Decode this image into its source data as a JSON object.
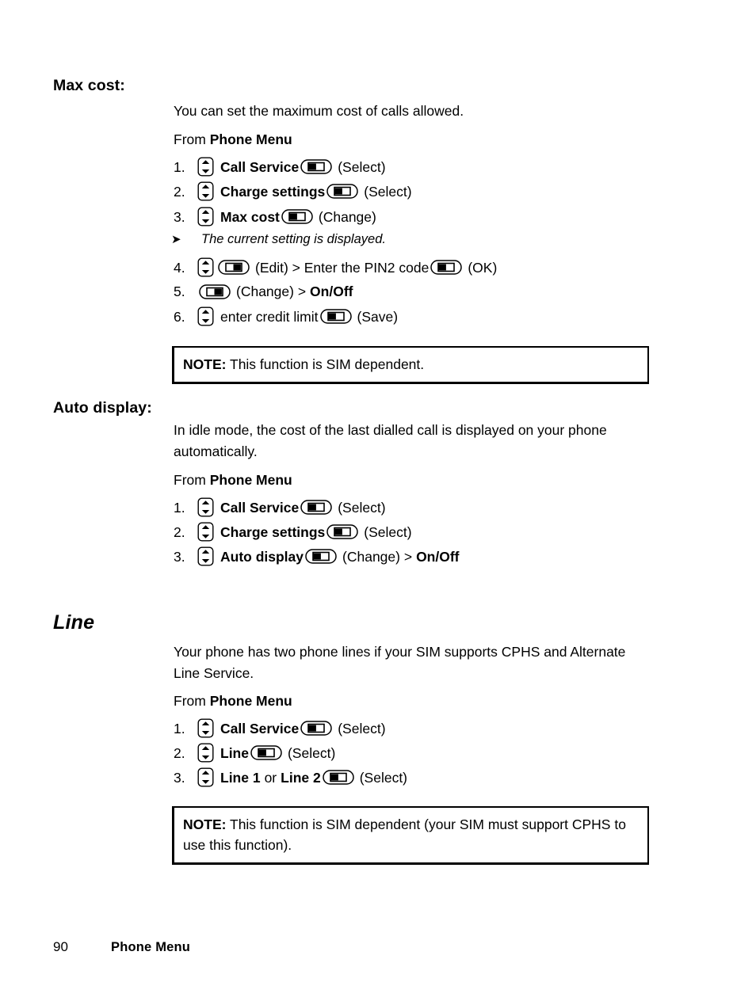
{
  "page": {
    "number": "90",
    "footer_title": "Phone Menu"
  },
  "icons": {
    "scroll_key": "scroll-up-down-key-icon",
    "softkey_left": "left-soft-key-icon",
    "softkey_right": "right-soft-key-icon",
    "tip_arrow": "➤"
  },
  "sections": [
    {
      "id": "max-cost",
      "heading": "Max cost:",
      "heading_style": "sub",
      "intro": "You can set the maximum cost of calls allowed.",
      "from_prefix": "From ",
      "from_target": "Phone Menu",
      "steps": [
        {
          "num": "1.",
          "parts": [
            {
              "t": "icon",
              "icon": "scroll"
            },
            {
              "t": "bold",
              "text": "Call Service"
            },
            {
              "t": "icon",
              "icon": "softkey_left"
            },
            {
              "t": "plain",
              "text": "(Select)"
            }
          ]
        },
        {
          "num": "2.",
          "parts": [
            {
              "t": "icon",
              "icon": "scroll"
            },
            {
              "t": "bold",
              "text": "Charge settings"
            },
            {
              "t": "icon",
              "icon": "softkey_left"
            },
            {
              "t": "plain",
              "text": "(Select)"
            }
          ]
        },
        {
          "num": "3.",
          "parts": [
            {
              "t": "icon",
              "icon": "scroll"
            },
            {
              "t": "bold",
              "text": "Max cost"
            },
            {
              "t": "icon",
              "icon": "softkey_left"
            },
            {
              "t": "plain",
              "text": "(Change)"
            }
          ]
        },
        {
          "num": "tip",
          "tip": "The current setting is displayed."
        },
        {
          "num": "4.",
          "parts": [
            {
              "t": "icon",
              "icon": "scroll"
            },
            {
              "t": "icon",
              "icon": "softkey_right"
            },
            {
              "t": "plain",
              "text": "(Edit) > Enter the PIN2 code"
            },
            {
              "t": "icon",
              "icon": "softkey_left"
            },
            {
              "t": "plain",
              "text": "(OK)"
            }
          ]
        },
        {
          "num": "5.",
          "parts": [
            {
              "t": "icon",
              "icon": "softkey_right"
            },
            {
              "t": "plain",
              "text": "(Change) >"
            },
            {
              "t": "bold",
              "text": "On/Off"
            }
          ]
        },
        {
          "num": "6.",
          "parts": [
            {
              "t": "icon",
              "icon": "scroll"
            },
            {
              "t": "plain",
              "text": "enter credit limit"
            },
            {
              "t": "icon",
              "icon": "softkey_left"
            },
            {
              "t": "plain",
              "text": "(Save)"
            }
          ]
        }
      ],
      "note": {
        "label": "NOTE:",
        "text": " This function is SIM dependent."
      }
    },
    {
      "id": "auto-display",
      "heading": "Auto display:",
      "heading_style": "sub",
      "intro": "In idle mode, the cost of the last dialled call is displayed on your phone automatically.",
      "from_prefix": "From ",
      "from_target": "Phone Menu",
      "steps": [
        {
          "num": "1.",
          "parts": [
            {
              "t": "icon",
              "icon": "scroll"
            },
            {
              "t": "bold",
              "text": "Call Service"
            },
            {
              "t": "icon",
              "icon": "softkey_left"
            },
            {
              "t": "plain",
              "text": "(Select)"
            }
          ]
        },
        {
          "num": "2.",
          "parts": [
            {
              "t": "icon",
              "icon": "scroll"
            },
            {
              "t": "bold",
              "text": "Charge settings"
            },
            {
              "t": "icon",
              "icon": "softkey_left"
            },
            {
              "t": "plain",
              "text": "(Select)"
            }
          ]
        },
        {
          "num": "3.",
          "parts": [
            {
              "t": "icon",
              "icon": "scroll"
            },
            {
              "t": "bold",
              "text": "Auto display"
            },
            {
              "t": "icon",
              "icon": "softkey_left"
            },
            {
              "t": "plain",
              "text": "(Change) >"
            },
            {
              "t": "bold",
              "text": "On/Off"
            }
          ]
        }
      ]
    },
    {
      "id": "line",
      "heading": "Line",
      "heading_style": "section",
      "intro": "Your phone has two phone lines if your SIM supports CPHS and Alternate Line Service.",
      "from_prefix": "From ",
      "from_target": "Phone Menu",
      "steps": [
        {
          "num": "1.",
          "parts": [
            {
              "t": "icon",
              "icon": "scroll"
            },
            {
              "t": "bold",
              "text": "Call Service"
            },
            {
              "t": "icon",
              "icon": "softkey_left"
            },
            {
              "t": "plain",
              "text": "(Select)"
            }
          ]
        },
        {
          "num": "2.",
          "parts": [
            {
              "t": "icon",
              "icon": "scroll"
            },
            {
              "t": "bold",
              "text": "Line"
            },
            {
              "t": "icon",
              "icon": "softkey_left"
            },
            {
              "t": "plain",
              "text": "(Select)"
            }
          ]
        },
        {
          "num": "3.",
          "parts": [
            {
              "t": "icon",
              "icon": "scroll"
            },
            {
              "t": "bold",
              "text": "Line 1"
            },
            {
              "t": "plain",
              "text": "or"
            },
            {
              "t": "bold",
              "text": "Line 2"
            },
            {
              "t": "icon",
              "icon": "softkey_left"
            },
            {
              "t": "plain",
              "text": "(Select)"
            }
          ]
        }
      ],
      "note": {
        "label": "NOTE:",
        "text": " This function is SIM dependent (your SIM must support CPHS to use this function)."
      }
    }
  ]
}
